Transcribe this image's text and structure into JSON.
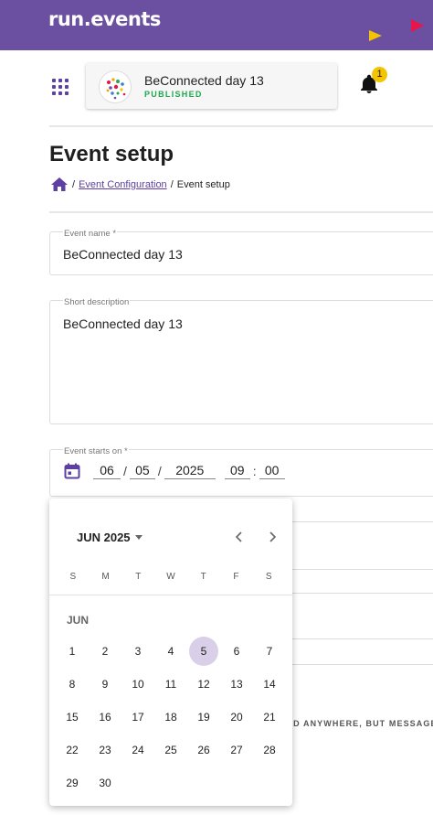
{
  "app": {
    "logo_text": "run.events"
  },
  "event": {
    "name": "BeConnected day 13",
    "status": "PUBLISHED"
  },
  "notifications": {
    "count": "1"
  },
  "page": {
    "title": "Event setup"
  },
  "breadcrumb": {
    "link": "Event Configuration",
    "current": "Event setup",
    "separator": "/"
  },
  "form": {
    "event_name": {
      "label": "Event name *",
      "value": "BeConnected day 13"
    },
    "short_description": {
      "label": "Short description",
      "value": "BeConnected day 13"
    },
    "starts_on": {
      "label": "Event starts on *",
      "month": "06",
      "day": "05",
      "year": "2025",
      "hour": "09",
      "minute": "00"
    }
  },
  "hint": {
    "text": "ED ANYWHERE, BUT MESSAGE"
  },
  "calendar": {
    "header": "JUN 2025",
    "month_tag": "JUN",
    "weekdays": [
      "S",
      "M",
      "T",
      "W",
      "T",
      "F",
      "S"
    ],
    "selected_day": "5",
    "weeks": [
      [
        "1",
        "2",
        "3",
        "4",
        "5",
        "6",
        "7"
      ],
      [
        "8",
        "9",
        "10",
        "11",
        "12",
        "13",
        "14"
      ],
      [
        "15",
        "16",
        "17",
        "18",
        "19",
        "20",
        "21"
      ],
      [
        "22",
        "23",
        "24",
        "25",
        "26",
        "27",
        "28"
      ],
      [
        "29",
        "30"
      ]
    ]
  },
  "colors": {
    "brand": "#6b4fa0",
    "accent_yellow": "#f5c400",
    "accent_red": "#e8144a",
    "status_green": "#1fa84f",
    "selected_day": "#d9cfe8"
  }
}
